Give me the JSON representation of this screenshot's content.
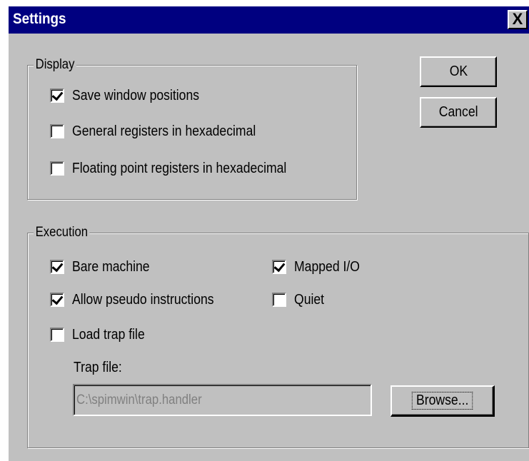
{
  "window": {
    "title": "Settings",
    "close_label": "X"
  },
  "buttons": {
    "ok": "OK",
    "cancel": "Cancel",
    "browse": "Browse..."
  },
  "display_group": {
    "legend": "Display",
    "items": [
      {
        "label": "Save window positions",
        "checked": true
      },
      {
        "label": "General registers in hexadecimal",
        "checked": false
      },
      {
        "label": "Floating point registers in hexadecimal",
        "checked": false
      }
    ]
  },
  "execution_group": {
    "legend": "Execution",
    "items": [
      {
        "label": "Bare machine",
        "checked": true
      },
      {
        "label": "Allow pseudo instructions",
        "checked": true
      },
      {
        "label": "Load trap file",
        "checked": false
      },
      {
        "label": "Mapped I/O",
        "checked": true
      },
      {
        "label": "Quiet",
        "checked": false
      }
    ],
    "trap_file_label": "Trap file:",
    "trap_file_value": "C:\\spimwin\\trap.handler"
  },
  "colors": {
    "titlebar": "#000080",
    "face": "#c0c0c0"
  }
}
